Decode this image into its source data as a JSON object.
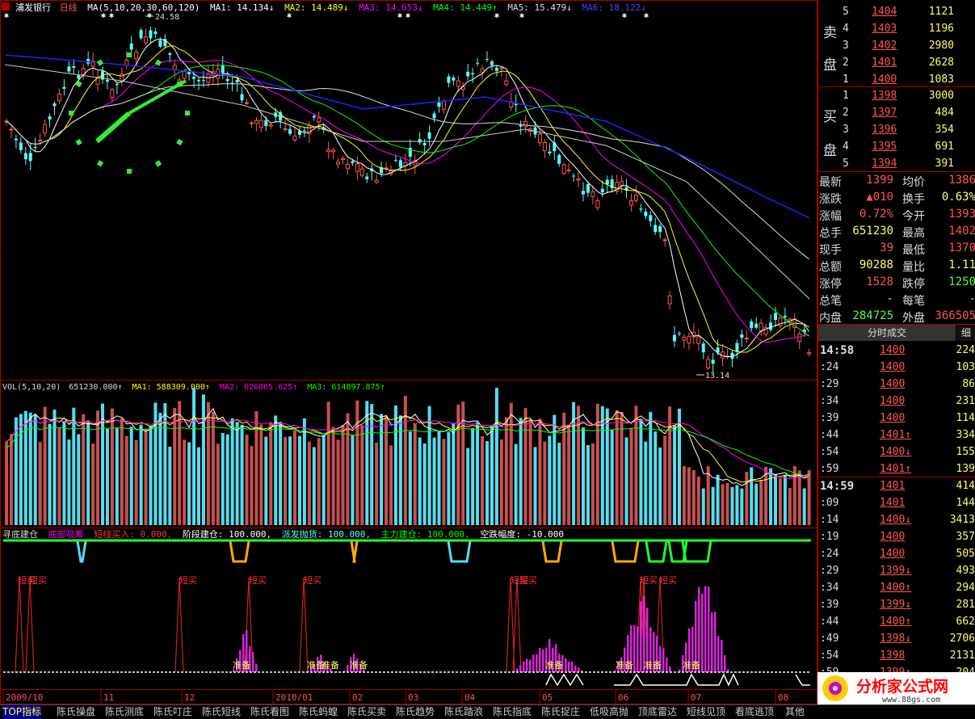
{
  "header": {
    "stock_name": "浦发银行",
    "period": "日线",
    "ma_label": "MA(5,10,20,30,60,120)",
    "ma1": "MA1: 14.134↓",
    "ma2": "MA2: 14.489↓",
    "ma3": "MA3: 14.653↓",
    "ma4": "MA4: 14.449↑",
    "ma5": "MA5: 15.479↓",
    "ma6": "MA6: 18.122↓",
    "high_mark": "24.58",
    "low_mark": "13.14"
  },
  "vol_header": {
    "label": "VOL(5,10,20)",
    "vol": "651230.000↑",
    "ma1": "MA1: 588309.000↑",
    "ma2": "MA2: 626065.625↑",
    "ma3": "MA3: 614897.875↑"
  },
  "ind_header": {
    "title": "寻底建仓",
    "a": "底部吸筹",
    "b": "短线买入: 0.000,",
    "c": "阶段建仓: 100.000,",
    "d": "派发抛货: 100.000,",
    "e": "主力建仓: 100.000,",
    "f": "空跌幅度: -10.000"
  },
  "signals": {
    "buy": "短买",
    "prep": "准备"
  },
  "date_axis": [
    "2009/10",
    "11",
    "12",
    "2010/01",
    "02",
    "03",
    "04",
    "05",
    "06",
    "07",
    "08"
  ],
  "orderbook": {
    "sell_label_1": "卖",
    "sell_label_2": "盘",
    "buy_label_1": "买",
    "buy_label_2": "盘",
    "sell": [
      {
        "lvl": "5",
        "price": "1404",
        "vol": "1121"
      },
      {
        "lvl": "4",
        "price": "1403",
        "vol": "1196"
      },
      {
        "lvl": "3",
        "price": "1402",
        "vol": "2980"
      },
      {
        "lvl": "2",
        "price": "1401",
        "vol": "2628"
      },
      {
        "lvl": "1",
        "price": "1400",
        "vol": "1083"
      }
    ],
    "buy": [
      {
        "lvl": "1",
        "price": "1398",
        "vol": "3000"
      },
      {
        "lvl": "2",
        "price": "1397",
        "vol": "484"
      },
      {
        "lvl": "3",
        "price": "1396",
        "vol": "354"
      },
      {
        "lvl": "4",
        "price": "1395",
        "vol": "691"
      },
      {
        "lvl": "5",
        "price": "1394",
        "vol": "391"
      }
    ]
  },
  "quote": [
    {
      "l": "最新",
      "v": "1399",
      "vc": "#ff5555",
      "l2": "均价",
      "v2": "1386",
      "v2c": "#ff5555"
    },
    {
      "l": "涨跌",
      "v": "▲010",
      "vc": "#ff5555",
      "l2": "换手",
      "v2": "0.63%",
      "v2c": "#ffff66"
    },
    {
      "l": "涨幅",
      "v": "0.72%",
      "vc": "#ff5555",
      "l2": "今开",
      "v2": "1393",
      "v2c": "#ff5555"
    },
    {
      "l": "总手",
      "v": "651230",
      "vc": "#ffff66",
      "l2": "最高",
      "v2": "1402",
      "v2c": "#ff5555"
    },
    {
      "l": "现手",
      "v": "39",
      "vc": "#ff5555",
      "l2": "最低",
      "v2": "1370",
      "v2c": "#ff5555"
    },
    {
      "l": "总额",
      "v": "90288",
      "vc": "#ffff66",
      "l2": "量比",
      "v2": "1.11",
      "v2c": "#ffff66"
    },
    {
      "l": "涨停",
      "v": "1528",
      "vc": "#ff5555",
      "l2": "跌停",
      "v2": "1250",
      "v2c": "#55ff55"
    },
    {
      "l": "总笔",
      "v": "-",
      "vc": "#ccc",
      "l2": "每笔",
      "v2": "-",
      "v2c": "#ccc"
    },
    {
      "l": "内盘",
      "v": "284725",
      "vc": "#55ff55",
      "l2": "外盘",
      "v2": "366505",
      "v2c": "#ff5555"
    }
  ],
  "trades_tab": "分时成交",
  "trades_tab2": "细",
  "trades": [
    {
      "t": "14:58",
      "p": "1400",
      "v": "224",
      "big": true
    },
    {
      "t": ":24",
      "p": "1400",
      "v": "103"
    },
    {
      "t": ":29",
      "p": "1400",
      "v": "86"
    },
    {
      "t": ":34",
      "p": "1400",
      "v": "231"
    },
    {
      "t": ":39",
      "p": "1400",
      "v": "114"
    },
    {
      "t": ":44",
      "p": "1401↑",
      "v": "334"
    },
    {
      "t": ":54",
      "p": "1400↓",
      "v": "155"
    },
    {
      "t": ":59",
      "p": "1401↑",
      "v": "139"
    },
    {
      "t": "14:59",
      "p": "1401",
      "v": "414",
      "big": true
    },
    {
      "t": ":09",
      "p": "1401",
      "v": "144"
    },
    {
      "t": ":14",
      "p": "1400↓",
      "v": "3413"
    },
    {
      "t": ":19",
      "p": "1400",
      "v": "357"
    },
    {
      "t": ":24",
      "p": "1400",
      "v": "505"
    },
    {
      "t": ":29",
      "p": "1399↓",
      "v": "493"
    },
    {
      "t": ":34",
      "p": "1400↑",
      "v": "294"
    },
    {
      "t": ":39",
      "p": "1399↓",
      "v": "281"
    },
    {
      "t": ":44",
      "p": "1400↑",
      "v": "662"
    },
    {
      "t": ":49",
      "p": "1398↓",
      "v": "2706"
    },
    {
      "t": ":54",
      "p": "1398",
      "v": "2131"
    },
    {
      "t": ":59",
      "p": "1399↑",
      "v": "204"
    }
  ],
  "tabs": [
    "TOP指标",
    "陈氏操盘",
    "陈氏测底",
    "陈氏叮庄",
    "陈氏短线",
    "陈氏看图",
    "陈氏蚂蝗",
    "陈氏买卖",
    "陈氏趋势",
    "陈氏踏浪",
    "陈氏指底",
    "陈氏捉庄",
    "低吸高抛",
    "顶底雷达",
    "短线见顶",
    "看底逃顶",
    "其他"
  ],
  "logo": {
    "text": "分析家公式网",
    "url": "www.88gs.com"
  },
  "colors": {
    "up": "#ff5555",
    "down": "#55ffff",
    "ma1": "#ffffff",
    "ma2": "#ffff00",
    "ma3": "#ff00ff",
    "ma4": "#00ff00",
    "ma5": "#dddddd",
    "ma6": "#0000ff",
    "border": "#aa0000"
  }
}
